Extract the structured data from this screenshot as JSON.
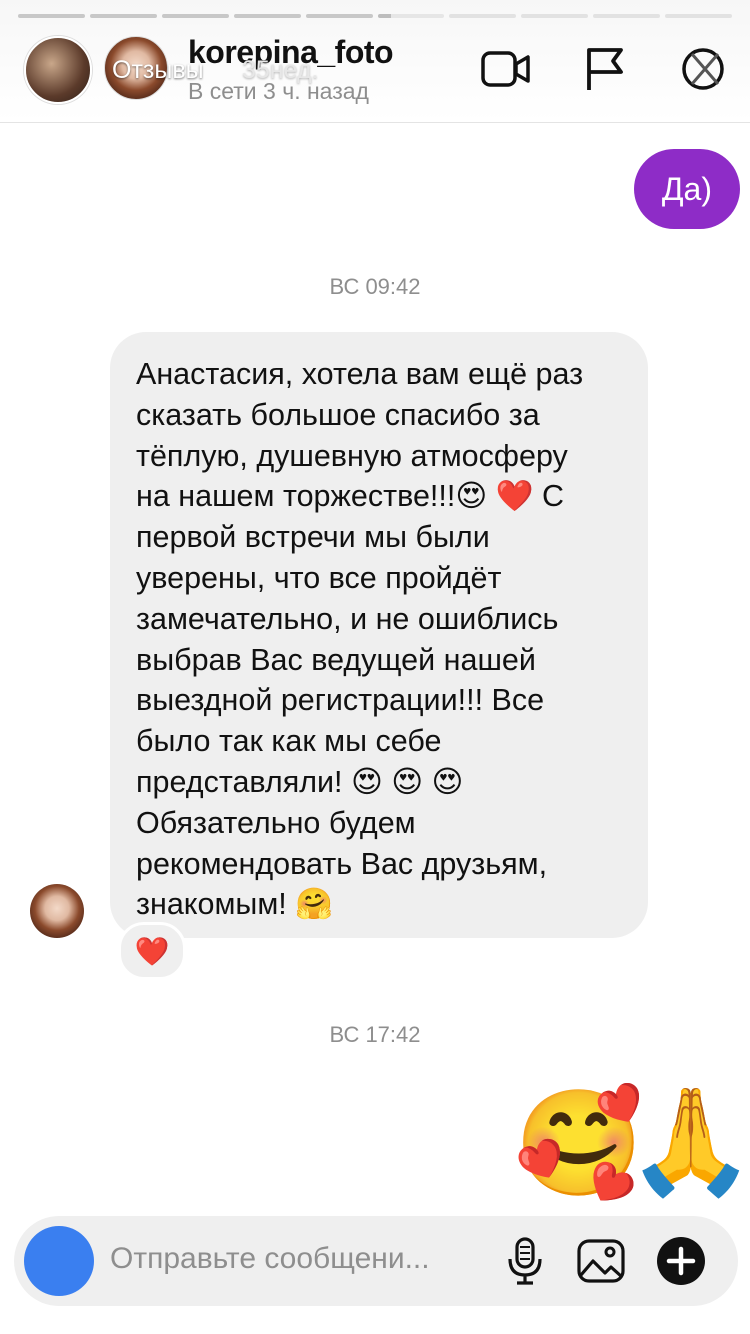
{
  "story": {
    "title": "Отзывы",
    "time": "35нед."
  },
  "header": {
    "username": "korepina_foto",
    "status": "В сети 3 ч. назад",
    "icons": [
      "video-call-icon",
      "flag-icon",
      "close-icon"
    ]
  },
  "messages": {
    "outgoing_1": "Да)",
    "timestamp_1": "ВС 09:42",
    "incoming_lines": [
      "Анастасия, хотела вам ещё раз",
      "сказать большое спасибо за",
      "тёплую, душевную атмосферу",
      "на нашем торжестве!!!😍 ❤️  С",
      "первой встречи мы были",
      "уверены, что все пройдёт",
      "замечательно, и не ошиблись",
      "выбрав Вас ведущей нашей",
      "выездной регистрации!!! Все",
      "было так как мы себе",
      "представляли! 😍 😍 😍",
      "Обязательно будем",
      "рекомендовать Вас друзьям,",
      "знакомым! 🤗"
    ],
    "reaction": "❤️",
    "timestamp_2": "ВС 17:42",
    "outgoing_emoji_1": "🥰",
    "outgoing_emoji_2": "🙏"
  },
  "composer": {
    "placeholder": "Отправьте сообщени...",
    "icons": [
      "microphone-icon",
      "image-icon",
      "plus-icon"
    ]
  },
  "colors": {
    "outgoing_bubble": "#8e2cc7",
    "incoming_bubble": "#efefef",
    "camera_button": "#3a7ff0"
  }
}
